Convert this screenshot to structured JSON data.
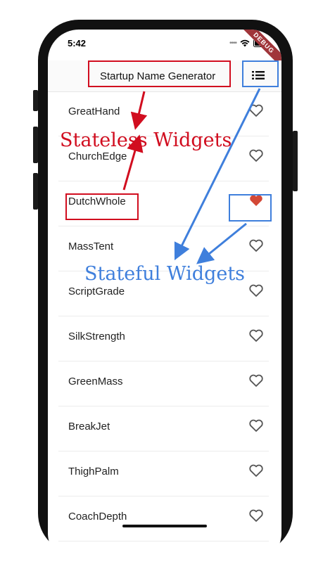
{
  "status_bar": {
    "time": "5:42",
    "debug_label": "DEBUG"
  },
  "app_bar": {
    "title": "Startup Name Generator",
    "action_icon": "list-icon"
  },
  "list": {
    "items": [
      {
        "label": "GreatHand",
        "favorited": false
      },
      {
        "label": "ChurchEdge",
        "favorited": false
      },
      {
        "label": "DutchWhole",
        "favorited": true
      },
      {
        "label": "MassTent",
        "favorited": false
      },
      {
        "label": "ScriptGrade",
        "favorited": false
      },
      {
        "label": "SilkStrength",
        "favorited": false
      },
      {
        "label": "GreenMass",
        "favorited": false
      },
      {
        "label": "BreakJet",
        "favorited": false
      },
      {
        "label": "ThighPalm",
        "favorited": false
      },
      {
        "label": "CoachDepth",
        "favorited": false
      }
    ]
  },
  "annotations": {
    "stateless_label": "Stateless Widgets",
    "stateful_label": "Stateful Widgets"
  },
  "colors": {
    "heart_filled": "#d34836",
    "heart_outline": "#555555",
    "annotation_red": "#d10d1f",
    "annotation_blue": "#3f7fdc"
  }
}
